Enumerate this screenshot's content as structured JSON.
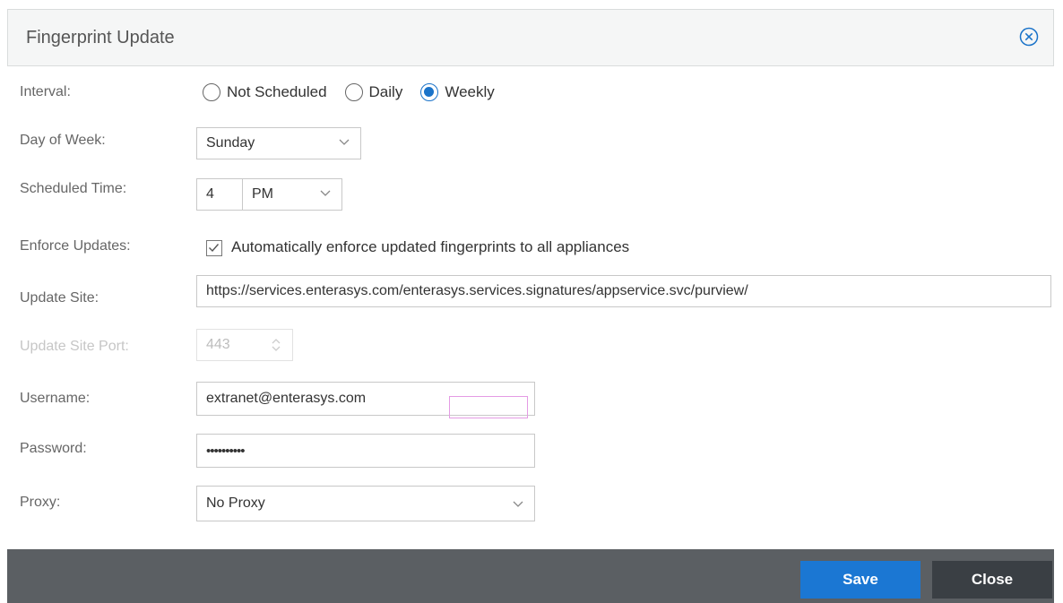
{
  "dialog": {
    "title": "Fingerprint Update",
    "close_icon": "close-circle-icon"
  },
  "interval": {
    "label": "Interval:",
    "options": [
      "Not Scheduled",
      "Daily",
      "Weekly"
    ],
    "selected": "Weekly"
  },
  "day_of_week": {
    "label": "Day of Week:",
    "value": "Sunday"
  },
  "scheduled_time": {
    "label": "Scheduled Time:",
    "hour": "4",
    "ampm": "PM"
  },
  "enforce_updates": {
    "label": "Enforce Updates:",
    "checkbox_label": "Automatically enforce updated fingerprints to all appliances",
    "checked": true
  },
  "update_site": {
    "label": "Update Site:",
    "value": "https://services.enterasys.com/enterasys.services.signatures/appservice.svc/purview/"
  },
  "update_site_port": {
    "label": "Update Site Port:",
    "value": "443",
    "disabled": true
  },
  "username": {
    "label": "Username:",
    "value": "extranet@enterasys.com"
  },
  "password": {
    "label": "Password:",
    "value": "••••••••••"
  },
  "proxy": {
    "label": "Proxy:",
    "value": "No Proxy"
  },
  "footer": {
    "save_label": "Save",
    "close_label": "Close"
  },
  "colors": {
    "accent": "#1b77d3",
    "footer_bg": "#5b5f63",
    "close_btn": "#3a3f44"
  }
}
